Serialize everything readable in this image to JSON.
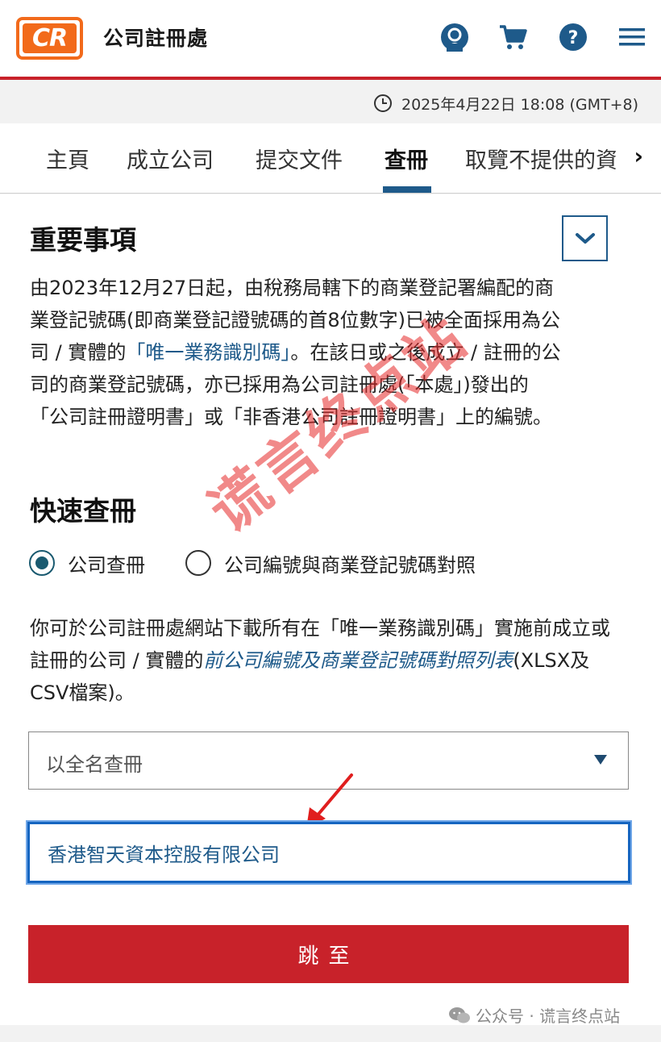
{
  "header": {
    "logo_text": "CR",
    "site_title": "公司註冊處",
    "icons": [
      "account-icon",
      "cart-icon",
      "help-icon",
      "menu-icon"
    ]
  },
  "datebar": {
    "datetime": "2025年4月22日 18:08 (GMT+8)"
  },
  "nav": {
    "tabs": [
      {
        "label": "主頁",
        "active": false
      },
      {
        "label": "成立公司",
        "active": false
      },
      {
        "label": "提交文件",
        "active": false
      },
      {
        "label": "查冊",
        "active": true
      },
      {
        "label": "取覽不提供的資",
        "active": false
      }
    ],
    "scroll_arrow": "›"
  },
  "notice": {
    "title": "重要事項",
    "body_part1": "由2023年12月27日起，由稅務局轄下的商業登記署編配的商業登記號碼(即商業登記證號碼的首8位數字)已被全面採用為公司 / 實體的",
    "body_link": "「唯一業務識別碼」",
    "body_part2": "。在該日或之後成立 / 註冊的公司的商業登記號碼，亦已採用為公司註冊處(「本處」)發出的「公司註冊證明書」或「非香港公司註冊證明書」上的編號。"
  },
  "quick_search": {
    "title": "快速查冊",
    "radio_options": [
      {
        "label": "公司查冊",
        "checked": true
      },
      {
        "label": "公司編號與商業登記號碼對照",
        "checked": false
      }
    ],
    "download_part1": "你可於公司註冊處網站下載所有在「唯一業務識別碼」實施前成立或註冊的公司 / 實體的",
    "download_link": "前公司編號及商業登記號碼對照列表",
    "download_part2": "(XLSX及CSV檔案)。",
    "select_value": "以全名查冊",
    "input_value": "香港智天資本控股有限公司",
    "submit_label": "跳至"
  },
  "watermark": {
    "text": "谎言终点站"
  },
  "caption": {
    "text": "公众号 · 谎言终点站"
  },
  "colors": {
    "brand_orange": "#f26a1b",
    "brand_red": "#c8222a",
    "accent_blue": "#1e5a8a"
  }
}
